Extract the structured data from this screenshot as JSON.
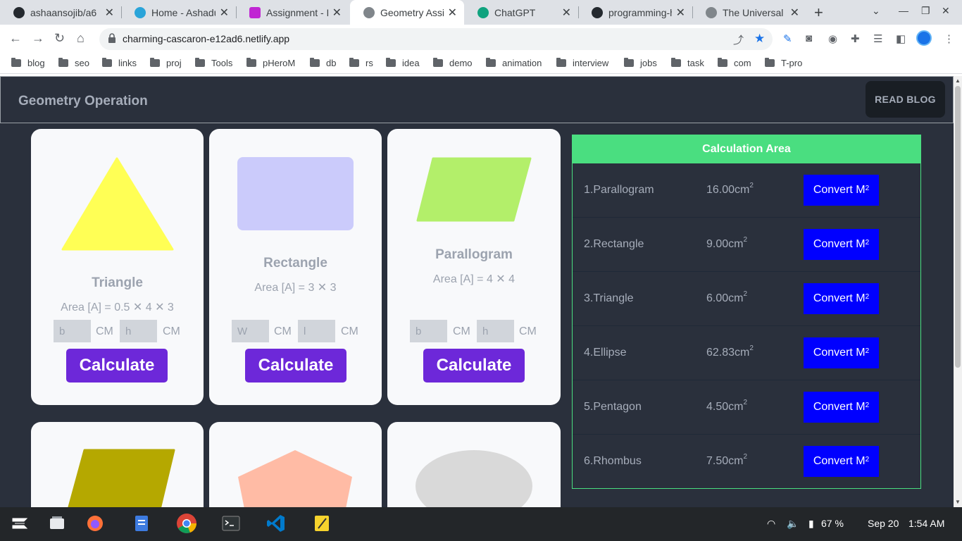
{
  "browser": {
    "tabs": [
      {
        "title": "ashaansojib/a6",
        "icon": "github-icon"
      },
      {
        "title": "Home - Ashadu",
        "icon": "avatar-icon"
      },
      {
        "title": "Assignment - P",
        "icon": "programming-hero-icon"
      },
      {
        "title": "Geometry Assi",
        "icon": "globe-icon",
        "active": true
      },
      {
        "title": "ChatGPT",
        "icon": "chatgpt-icon"
      },
      {
        "title": "programming-h",
        "icon": "github-icon"
      },
      {
        "title": "The Universal /",
        "icon": "globe-icon"
      }
    ],
    "url": "charming-cascaron-e12ad6.netlify.app",
    "bookmarks": [
      "blog",
      "seo",
      "links",
      "proj",
      "Tools",
      "pHeroM",
      "db",
      "rs",
      "idea",
      "demo",
      "animation",
      "interview",
      "jobs",
      "task",
      "com",
      "T-pro"
    ]
  },
  "page": {
    "brand": "Geometry Operation",
    "read_blog": "READ BLOG",
    "cards": [
      {
        "title": "Triangle",
        "formula": "Area [A] = 0.5 ✕ 4 ✕ 3",
        "input1": "b",
        "input2": "h",
        "unit": "CM",
        "button": "Calculate",
        "color": "#ffff55"
      },
      {
        "title": "Rectangle",
        "formula": "Area [A] = 3 ✕ 3",
        "input1": "W",
        "input2": "l",
        "unit": "CM",
        "button": "Calculate",
        "color": "#cbcbfb"
      },
      {
        "title": "Parallogram",
        "formula": "Area [A] = 4 ✕ 4",
        "input1": "b",
        "input2": "h",
        "unit": "CM",
        "button": "Calculate",
        "color": "#b3ef6a"
      }
    ],
    "lower_cards_colors": [
      "#b5a800",
      "#ffbba5",
      "#d9d9d9"
    ],
    "calculation": {
      "header": "Calculation Area",
      "rows": [
        {
          "name": "1.Parallogram",
          "value": "16.00cm",
          "button": "Convert M"
        },
        {
          "name": "2.Rectangle",
          "value": "9.00cm",
          "button": "Convert M"
        },
        {
          "name": "3.Triangle",
          "value": "6.00cm",
          "button": "Convert M"
        },
        {
          "name": "4.Ellipse",
          "value": "62.83cm",
          "button": "Convert M"
        },
        {
          "name": "5.Pentagon",
          "value": "4.50cm",
          "button": "Convert M"
        },
        {
          "name": "6.Rhombus",
          "value": "7.50cm",
          "button": "Convert M"
        }
      ],
      "superscript": "2"
    }
  },
  "taskbar": {
    "battery": "67 %",
    "date": "Sep 20",
    "time": "1:54 AM"
  }
}
